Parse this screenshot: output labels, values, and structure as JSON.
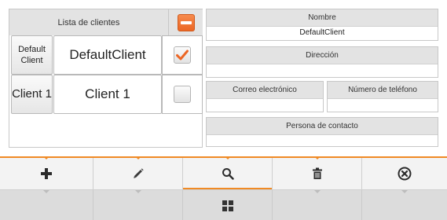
{
  "client_list": {
    "header": "Lista de clientes",
    "rows": [
      {
        "code": "Default Client",
        "name": "DefaultClient",
        "checked": true
      },
      {
        "code": "Client 1",
        "name": "Client 1",
        "checked": false
      }
    ]
  },
  "details": {
    "name_label": "Nombre",
    "name_value": "DefaultClient",
    "address_label": "Dirección",
    "address_value": "",
    "email_label": "Correo electrónico",
    "email_value": "",
    "phone_label": "Número de teléfono",
    "phone_value": "",
    "contact_label": "Persona de contacto",
    "contact_value": ""
  },
  "toolbar": {
    "buttons": [
      {
        "icon": "plus-icon"
      },
      {
        "icon": "pencil-icon"
      },
      {
        "icon": "search-icon",
        "active": true
      },
      {
        "icon": "trash-icon"
      },
      {
        "icon": "cancel-circle-icon"
      }
    ]
  },
  "bottombar": {
    "icon": "grid-menu-icon"
  },
  "colors": {
    "accent": "#f08a24",
    "header_bg": "#e3e3e3",
    "toolbar_bg": "#f3f3f3",
    "bottombar_bg": "#dcdcdc"
  }
}
